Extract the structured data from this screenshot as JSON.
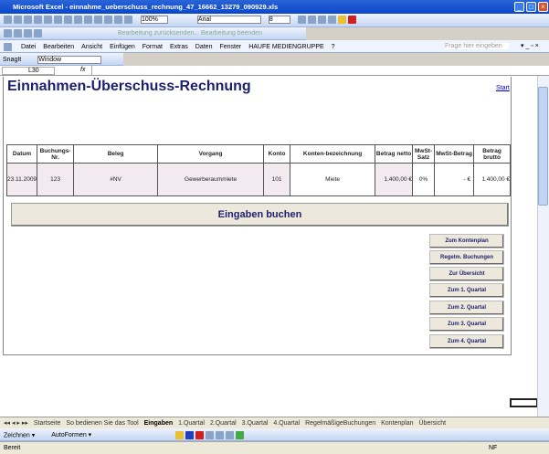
{
  "window": {
    "title": "Microsoft Excel - einnahme_ueberschuss_rechnung_47_16662_13279_090929.xls"
  },
  "toolbar": {
    "zoom": "100%",
    "font": "Arial",
    "font_size": "8",
    "review_label": "Bearbeitung zurücksenden... Bearbeitung beenden"
  },
  "menu": {
    "items": [
      "Datei",
      "Bearbeiten",
      "Ansicht",
      "Einfügen",
      "Format",
      "Extras",
      "Daten",
      "Fenster",
      "HAUFE MEDIENGRUPPE",
      "?"
    ],
    "help_placeholder": "Frage hier eingeben"
  },
  "snagit": {
    "label": "SnagIt",
    "window": "Window"
  },
  "formula": {
    "cell_ref": "L30",
    "fx": "fx"
  },
  "sheet": {
    "title": "Einnahmen-Überschuss-Rechnung",
    "start_link": "Start",
    "headers": [
      "Datum",
      "Buchungs-Nr.",
      "Beleg",
      "Vorgang",
      "Konto",
      "Konten-bezeichnung",
      "Betrag netto",
      "MwSt-Satz",
      "MwSt-Betrag",
      "Betrag brutto"
    ],
    "row": [
      "23.11.2009",
      "123",
      "#NV",
      "Gewerberaummiete",
      "101",
      "Miete",
      "1.400,00 €",
      "0%",
      "-   €",
      "1.400,00 €"
    ],
    "main_button": "Eingaben buchen",
    "buttons": [
      "Zum Kontenplan",
      "Regelm. Buchungen",
      "Zur Übersicht",
      "Zum 1. Quartal",
      "Zum 2. Quartal",
      "Zum 3. Quartal",
      "Zum 4. Quartal"
    ]
  },
  "tabs": {
    "items": [
      "Startseite",
      "So bedienen Sie das Tool",
      "Eingaben",
      "1.Quartal",
      "2.Quartal",
      "3.Quartal",
      "4.Quartal",
      "RegelmäßigeBuchungen",
      "Kontenplan",
      "Übersicht"
    ],
    "active": "Eingaben"
  },
  "drawing": {
    "draw": "Zeichnen ▾",
    "autoshapes": "AutoFormen ▾"
  },
  "status": {
    "left": "Bereit",
    "right": "NF"
  },
  "colors": {
    "title_bar": "#0a46c8",
    "heading": "#1c1f6e",
    "button_face": "#ece8dc"
  }
}
